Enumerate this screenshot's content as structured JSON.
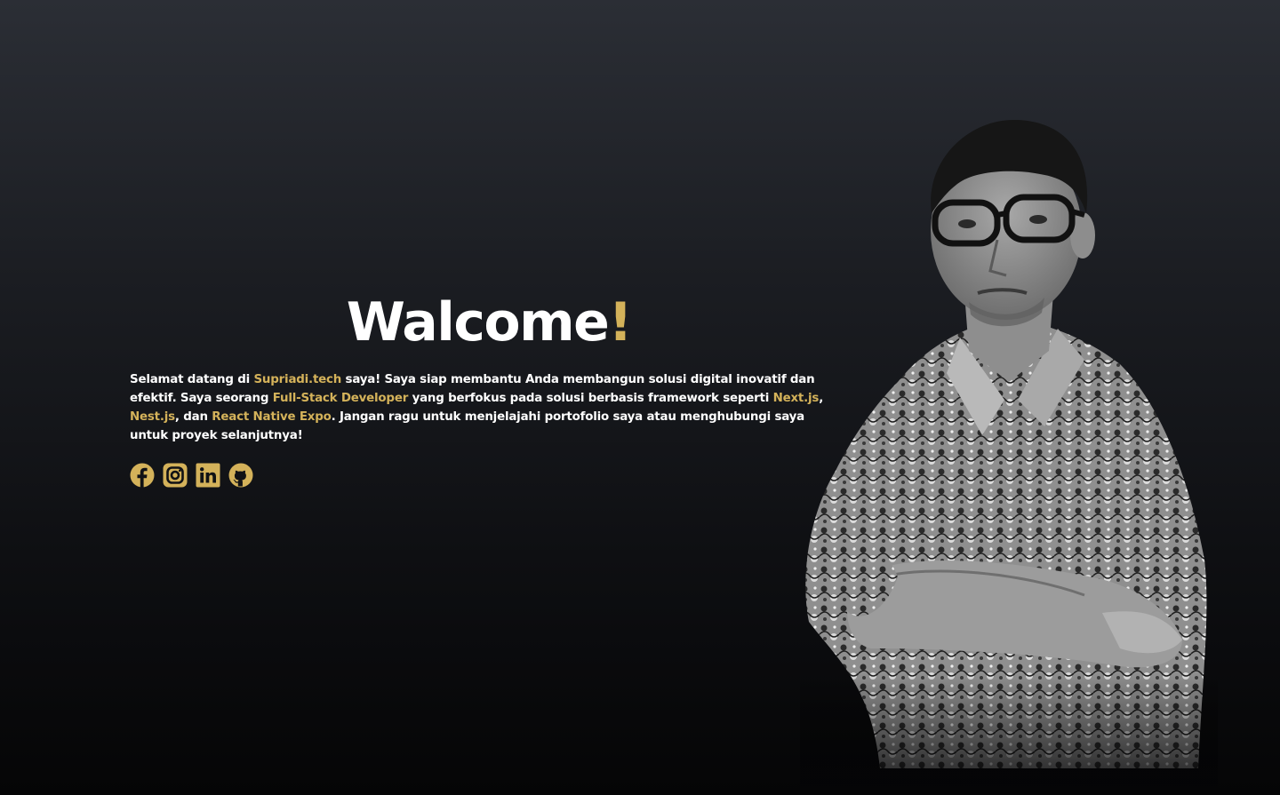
{
  "hero": {
    "headline": "Walcome",
    "headline_mark": "!",
    "intro": {
      "p1": "Selamat datang di ",
      "site": "Supriadi.tech",
      "p2": " saya! Saya siap membantu Anda membangun solusi digital inovatif dan efektif. Saya seorang ",
      "role": "Full-Stack Developer",
      "p3": " yang berfokus pada solusi berbasis framework seperti ",
      "fw1": "Next.js",
      "p4": ", ",
      "fw2": "Nest.js",
      "p5": ", dan ",
      "fw3": "React Native Expo",
      "p6": ". Jangan ragu untuk menjelajahi portofolio saya atau menghubungi saya untuk proyek selanjutnya!"
    }
  },
  "socials": [
    {
      "icon": "facebook-icon"
    },
    {
      "icon": "instagram-icon"
    },
    {
      "icon": "linkedin-icon"
    },
    {
      "icon": "github-icon"
    }
  ],
  "colors": {
    "accent": "#d4b25a",
    "text": "#ffffff",
    "background_top": "#2b2e35",
    "background_bottom": "#050506"
  }
}
